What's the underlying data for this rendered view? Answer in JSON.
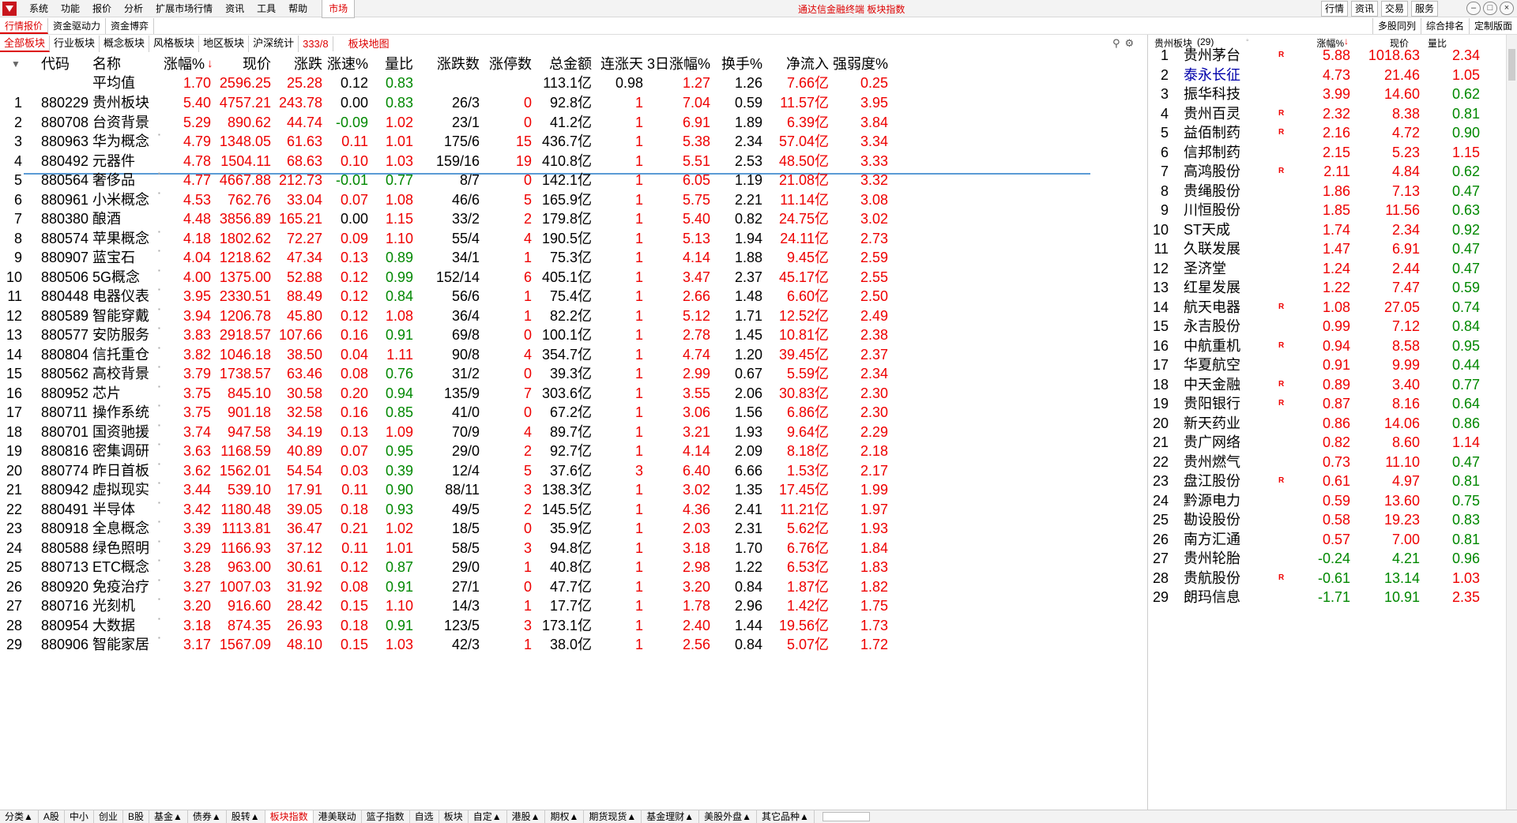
{
  "menubar": {
    "items": [
      "系统",
      "功能",
      "报价",
      "分析",
      "扩展市场行情",
      "资讯",
      "工具",
      "帮助"
    ],
    "market": "市场",
    "title": "通达信金融终端  板块指数",
    "right_buttons": [
      "行情",
      "资讯",
      "交易",
      "服务"
    ]
  },
  "tabs_top": [
    "行情报价",
    "资金驱动力",
    "资金博弈"
  ],
  "tabs_top_right": [
    "多股同列",
    "综合排名",
    "定制版面"
  ],
  "tabs_sector": [
    "全部板块",
    "行业板块",
    "概念板块",
    "风格板块",
    "地区板块",
    "沪深统计"
  ],
  "sector_count": "333/8",
  "sector_map": "板块地图",
  "table": {
    "headers": [
      "代码",
      "名称",
      "涨幅%",
      "现价",
      "涨跌",
      "涨速%",
      "量比",
      "涨跌数",
      "涨停数",
      "总金额",
      "连涨天",
      "3日涨幅%",
      "换手%",
      "净流入",
      "强弱度%"
    ],
    "average": {
      "name": "平均值",
      "pct": "1.70",
      "price": "2596.25",
      "chg": "25.28",
      "speed": "0.12",
      "vr": "0.83",
      "amt": "113.1亿",
      "days": "0.98",
      "d3": "1.27",
      "turn": "1.26",
      "flow": "7.66亿",
      "str": "0.25"
    },
    "rows": [
      [
        "1",
        "880229",
        "贵州板块",
        "5.40",
        "4757.21",
        "243.78",
        "0.00",
        "0.83",
        "26/3",
        "0",
        "92.8亿",
        "1",
        "7.04",
        "0.59",
        "11.57亿",
        "3.95"
      ],
      [
        "2",
        "880708",
        "台资背景",
        "5.29",
        "890.62",
        "44.74",
        "-0.09",
        "1.02",
        "23/1",
        "0",
        "41.2亿",
        "1",
        "6.91",
        "1.89",
        "6.39亿",
        "3.84"
      ],
      [
        "3",
        "880963",
        "华为概念",
        "4.79",
        "1348.05",
        "61.63",
        "0.11",
        "1.01",
        "175/6",
        "15",
        "436.7亿",
        "1",
        "5.38",
        "2.34",
        "57.04亿",
        "3.34"
      ],
      [
        "4",
        "880492",
        "元器件",
        "4.78",
        "1504.11",
        "68.63",
        "0.10",
        "1.03",
        "159/16",
        "19",
        "410.8亿",
        "1",
        "5.51",
        "2.53",
        "48.50亿",
        "3.33"
      ],
      [
        "5",
        "880564",
        "奢侈品",
        "4.77",
        "4667.88",
        "212.73",
        "-0.01",
        "0.77",
        "8/7",
        "0",
        "142.1亿",
        "1",
        "6.05",
        "1.19",
        "21.08亿",
        "3.32"
      ],
      [
        "6",
        "880961",
        "小米概念",
        "4.53",
        "762.76",
        "33.04",
        "0.07",
        "1.08",
        "46/6",
        "5",
        "165.9亿",
        "1",
        "5.75",
        "2.21",
        "11.14亿",
        "3.08"
      ],
      [
        "7",
        "880380",
        "酿酒",
        "4.48",
        "3856.89",
        "165.21",
        "0.00",
        "1.15",
        "33/2",
        "2",
        "179.8亿",
        "1",
        "5.40",
        "0.82",
        "24.75亿",
        "3.02"
      ],
      [
        "8",
        "880574",
        "苹果概念",
        "4.18",
        "1802.62",
        "72.27",
        "0.09",
        "1.10",
        "55/4",
        "4",
        "190.5亿",
        "1",
        "5.13",
        "1.94",
        "24.11亿",
        "2.73"
      ],
      [
        "9",
        "880907",
        "蓝宝石",
        "4.04",
        "1218.62",
        "47.34",
        "0.13",
        "0.89",
        "34/1",
        "1",
        "75.3亿",
        "1",
        "4.14",
        "1.88",
        "9.45亿",
        "2.59"
      ],
      [
        "10",
        "880506",
        "5G概念",
        "4.00",
        "1375.00",
        "52.88",
        "0.12",
        "0.99",
        "152/14",
        "6",
        "405.1亿",
        "1",
        "3.47",
        "2.37",
        "45.17亿",
        "2.55"
      ],
      [
        "11",
        "880448",
        "电器仪表",
        "3.95",
        "2330.51",
        "88.49",
        "0.12",
        "0.84",
        "56/6",
        "1",
        "75.4亿",
        "1",
        "2.66",
        "1.48",
        "6.60亿",
        "2.50"
      ],
      [
        "12",
        "880589",
        "智能穿戴",
        "3.94",
        "1206.78",
        "45.80",
        "0.12",
        "1.08",
        "36/4",
        "1",
        "82.2亿",
        "1",
        "5.12",
        "1.71",
        "12.52亿",
        "2.49"
      ],
      [
        "13",
        "880577",
        "安防服务",
        "3.83",
        "2918.57",
        "107.66",
        "0.16",
        "0.91",
        "69/8",
        "0",
        "100.1亿",
        "1",
        "2.78",
        "1.45",
        "10.81亿",
        "2.38"
      ],
      [
        "14",
        "880804",
        "信托重仓",
        "3.82",
        "1046.18",
        "38.50",
        "0.04",
        "1.11",
        "90/8",
        "4",
        "354.7亿",
        "1",
        "4.74",
        "1.20",
        "39.45亿",
        "2.37"
      ],
      [
        "15",
        "880562",
        "高校背景",
        "3.79",
        "1738.57",
        "63.46",
        "0.08",
        "0.76",
        "31/2",
        "0",
        "39.3亿",
        "1",
        "2.99",
        "0.67",
        "5.59亿",
        "2.34"
      ],
      [
        "16",
        "880952",
        "芯片",
        "3.75",
        "845.10",
        "30.58",
        "0.20",
        "0.94",
        "135/9",
        "7",
        "303.6亿",
        "1",
        "3.55",
        "2.06",
        "30.83亿",
        "2.30"
      ],
      [
        "17",
        "880711",
        "操作系统",
        "3.75",
        "901.18",
        "32.58",
        "0.16",
        "0.85",
        "41/0",
        "0",
        "67.2亿",
        "1",
        "3.06",
        "1.56",
        "6.86亿",
        "2.30"
      ],
      [
        "18",
        "880701",
        "国资驰援",
        "3.74",
        "947.58",
        "34.19",
        "0.13",
        "1.09",
        "70/9",
        "4",
        "89.7亿",
        "1",
        "3.21",
        "1.93",
        "9.64亿",
        "2.29"
      ],
      [
        "19",
        "880816",
        "密集调研",
        "3.63",
        "1168.59",
        "40.89",
        "0.07",
        "0.95",
        "29/0",
        "2",
        "92.7亿",
        "1",
        "4.14",
        "2.09",
        "8.18亿",
        "2.18"
      ],
      [
        "20",
        "880774",
        "昨日首板",
        "3.62",
        "1562.01",
        "54.54",
        "0.03",
        "0.39",
        "12/4",
        "5",
        "37.6亿",
        "3",
        "6.40",
        "6.66",
        "1.53亿",
        "2.17"
      ],
      [
        "21",
        "880942",
        "虚拟现实",
        "3.44",
        "539.10",
        "17.91",
        "0.11",
        "0.90",
        "88/11",
        "3",
        "138.3亿",
        "1",
        "3.02",
        "1.35",
        "17.45亿",
        "1.99"
      ],
      [
        "22",
        "880491",
        "半导体",
        "3.42",
        "1180.48",
        "39.05",
        "0.18",
        "0.93",
        "49/5",
        "2",
        "145.5亿",
        "1",
        "4.36",
        "2.41",
        "11.21亿",
        "1.97"
      ],
      [
        "23",
        "880918",
        "全息概念",
        "3.39",
        "1113.81",
        "36.47",
        "0.21",
        "1.02",
        "18/5",
        "0",
        "35.9亿",
        "1",
        "2.03",
        "2.31",
        "5.62亿",
        "1.93"
      ],
      [
        "24",
        "880588",
        "绿色照明",
        "3.29",
        "1166.93",
        "37.12",
        "0.11",
        "1.01",
        "58/5",
        "3",
        "94.8亿",
        "1",
        "3.18",
        "1.70",
        "6.76亿",
        "1.84"
      ],
      [
        "25",
        "880713",
        "ETC概念",
        "3.28",
        "963.00",
        "30.61",
        "0.12",
        "0.87",
        "29/0",
        "1",
        "40.8亿",
        "1",
        "2.98",
        "1.22",
        "6.53亿",
        "1.83"
      ],
      [
        "26",
        "880920",
        "免疫治疗",
        "3.27",
        "1007.03",
        "31.92",
        "0.08",
        "0.91",
        "27/1",
        "0",
        "47.7亿",
        "1",
        "3.20",
        "0.84",
        "1.87亿",
        "1.82"
      ],
      [
        "27",
        "880716",
        "光刻机",
        "3.20",
        "916.60",
        "28.42",
        "0.15",
        "1.10",
        "14/3",
        "1",
        "17.7亿",
        "1",
        "1.78",
        "2.96",
        "1.42亿",
        "1.75"
      ],
      [
        "28",
        "880954",
        "大数据",
        "3.18",
        "874.35",
        "26.93",
        "0.18",
        "0.91",
        "123/5",
        "3",
        "173.1亿",
        "1",
        "2.40",
        "1.44",
        "19.56亿",
        "1.73"
      ],
      [
        "29",
        "880906",
        "智能家居",
        "3.17",
        "1567.09",
        "48.10",
        "0.15",
        "1.03",
        "42/3",
        "1",
        "38.0亿",
        "1",
        "2.56",
        "0.84",
        "5.07亿",
        "1.72"
      ]
    ],
    "marked_rows": [
      3,
      5,
      6,
      8,
      9,
      10,
      11,
      12,
      13,
      14,
      15,
      16,
      17,
      18,
      19,
      20,
      21,
      22,
      23,
      24,
      25,
      26,
      27,
      28,
      29
    ]
  },
  "right_panel": {
    "title": "贵州板块",
    "title_count": "(29)",
    "headers": [
      "涨幅%",
      "现价",
      "量比"
    ],
    "rows": [
      [
        "1",
        "贵州茅台",
        "R",
        "5.88",
        "1018.63",
        "2.34"
      ],
      [
        "2",
        "泰永长征",
        "",
        "4.73",
        "21.46",
        "1.05"
      ],
      [
        "3",
        "振华科技",
        "",
        "3.99",
        "14.60",
        "0.62"
      ],
      [
        "4",
        "贵州百灵",
        "R",
        "2.32",
        "8.38",
        "0.81"
      ],
      [
        "5",
        "益佰制药",
        "R",
        "2.16",
        "4.72",
        "0.90"
      ],
      [
        "6",
        "信邦制药",
        "",
        "2.15",
        "5.23",
        "1.15"
      ],
      [
        "7",
        "高鸿股份",
        "R",
        "2.11",
        "4.84",
        "0.62"
      ],
      [
        "8",
        "贵绳股份",
        "",
        "1.86",
        "7.13",
        "0.47"
      ],
      [
        "9",
        "川恒股份",
        "",
        "1.85",
        "11.56",
        "0.63"
      ],
      [
        "10",
        "ST天成",
        "",
        "1.74",
        "2.34",
        "0.92"
      ],
      [
        "11",
        "久联发展",
        "",
        "1.47",
        "6.91",
        "0.47"
      ],
      [
        "12",
        "圣济堂",
        "",
        "1.24",
        "2.44",
        "0.47"
      ],
      [
        "13",
        "红星发展",
        "",
        "1.22",
        "7.47",
        "0.59"
      ],
      [
        "14",
        "航天电器",
        "R",
        "1.08",
        "27.05",
        "0.74"
      ],
      [
        "15",
        "永吉股份",
        "",
        "0.99",
        "7.12",
        "0.84"
      ],
      [
        "16",
        "中航重机",
        "R",
        "0.94",
        "8.58",
        "0.95"
      ],
      [
        "17",
        "华夏航空",
        "",
        "0.91",
        "9.99",
        "0.44"
      ],
      [
        "18",
        "中天金融",
        "R",
        "0.89",
        "3.40",
        "0.77"
      ],
      [
        "19",
        "贵阳银行",
        "R",
        "0.87",
        "8.16",
        "0.64"
      ],
      [
        "20",
        "新天药业",
        "",
        "0.86",
        "14.06",
        "0.86"
      ],
      [
        "21",
        "贵广网络",
        "",
        "0.82",
        "8.60",
        "1.14"
      ],
      [
        "22",
        "贵州燃气",
        "",
        "0.73",
        "11.10",
        "0.47"
      ],
      [
        "23",
        "盘江股份",
        "R",
        "0.61",
        "4.97",
        "0.81"
      ],
      [
        "24",
        "黔源电力",
        "",
        "0.59",
        "13.60",
        "0.75"
      ],
      [
        "25",
        "勘设股份",
        "",
        "0.58",
        "19.23",
        "0.83"
      ],
      [
        "26",
        "南方汇通",
        "",
        "0.57",
        "7.00",
        "0.81"
      ],
      [
        "27",
        "贵州轮胎",
        "",
        "-0.24",
        "4.21",
        "0.96"
      ],
      [
        "28",
        "贵航股份",
        "R",
        "-0.61",
        "13.14",
        "1.03"
      ],
      [
        "29",
        "朗玛信息",
        "",
        "-1.71",
        "10.91",
        "2.35"
      ]
    ]
  },
  "bottom_tabs": [
    "分类▲",
    "A股",
    "中小",
    "创业",
    "B股",
    "基金▲",
    "债券▲",
    "股转▲",
    "板块指数",
    "港美联动",
    "篮子指数",
    "自选",
    "板块",
    "自定▲",
    "港股▲",
    "期权▲",
    "期货现货▲",
    "基金理财▲",
    "美股外盘▲",
    "其它品种▲"
  ],
  "colors": {
    "up": "#e00000",
    "down": "#008000",
    "accent": "#d00000",
    "sep": "#5b9bd5"
  }
}
